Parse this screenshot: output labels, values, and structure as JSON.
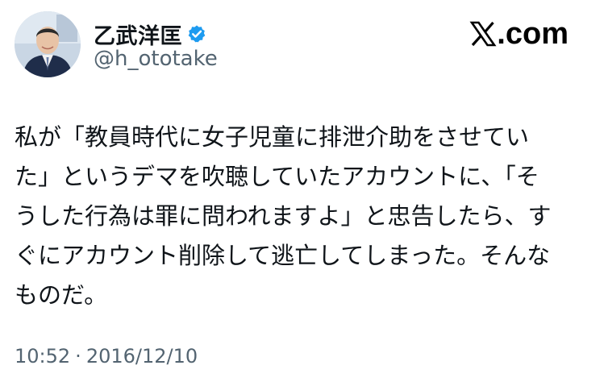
{
  "header": {
    "display_name": "乙武洋匡",
    "handle": "@h_ototake",
    "verified": true,
    "brand_text": ".com"
  },
  "icons": {
    "avatar": "profile-photo",
    "verified": "verified-badge-icon",
    "brand_logo": "x-logo-icon"
  },
  "tweet": {
    "lines": [
      "私が「教員時代に女子児童に排泄介助をさせてい",
      "た」というデマを吹聴していたアカウントに、「そ",
      "うした行為は罪に問われますよ」と忠告したら、す",
      "ぐにアカウント削除して逃亡してしまった。そんな",
      "ものだ。"
    ]
  },
  "meta": {
    "time": "10:52",
    "separator": "·",
    "date": "2016/12/10"
  },
  "colors": {
    "text": "#0f1419",
    "secondary": "#536471",
    "verified_blue": "#1d9bf0",
    "background": "#ffffff"
  }
}
